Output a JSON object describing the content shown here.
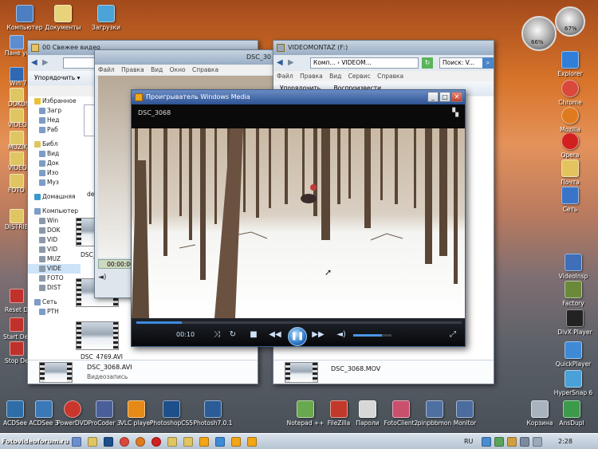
{
  "desktop": {
    "top_icons": [
      {
        "label": "Компьютер",
        "color": "#4b7fc1"
      },
      {
        "label": "Документы",
        "color": "#e8d27a"
      },
      {
        "label": "Загрузки",
        "color": "#4ba3d6"
      }
    ],
    "left_labels": [
      "Пане управл",
      "Win 7",
      "DOKUM",
      "VIDEO",
      "MUZIK",
      "VIDEO",
      "FOTO",
      "DISTRIB",
      "Reset De",
      "Start De",
      "Stop De"
    ],
    "right_icons": [
      {
        "label": "Explorer",
        "color": "#2f7fd8"
      },
      {
        "label": "Chrome",
        "color": "#d9483b"
      },
      {
        "label": "Mozilla",
        "color": "#e07a1f"
      },
      {
        "label": "Opera",
        "color": "#d21f1f"
      },
      {
        "label": "Почта",
        "color": "#e3c35e"
      },
      {
        "label": "Сеть",
        "color": "#3a74c8"
      },
      {
        "label": "VideoInsp",
        "color": "#3f6fb8"
      },
      {
        "label": "Factory",
        "color": "#6a8a3a"
      },
      {
        "label": "DivX Player",
        "color": "#222222"
      },
      {
        "label": "QuickPlayer",
        "color": "#3e8ad6"
      },
      {
        "label": "HyperSnap 6",
        "color": "#4aa0d8"
      },
      {
        "label": "Корзина",
        "color": "#a9b3bd"
      },
      {
        "label": "AnsDupl",
        "color": "#3b9b4a"
      }
    ],
    "bottom_icons": [
      {
        "label": "ACDSee",
        "color": "#2e6da8"
      },
      {
        "label": "ACDSee 3",
        "color": "#3a78b8"
      },
      {
        "label": "PowerDVD",
        "color": "#c9362c"
      },
      {
        "label": "ProCoder 3",
        "color": "#4a5f9a"
      },
      {
        "label": "VLC player",
        "color": "#e58a17"
      },
      {
        "label": "PhotoshopCS5",
        "color": "#1d4f8a"
      },
      {
        "label": "Photosh7.0.1",
        "color": "#2a5d97"
      },
      {
        "label": "Notepad ++",
        "color": "#6aa84f"
      },
      {
        "label": "FileZilla",
        "color": "#c0392b"
      },
      {
        "label": "Пароли",
        "color": "#d7d7d7"
      },
      {
        "label": "FotoClient2",
        "color": "#c94f6d"
      },
      {
        "label": "pinpbbmon",
        "color": "#4f6fa0"
      },
      {
        "label": "Monitor",
        "color": "#4b6c9c"
      }
    ],
    "gadget_values": [
      "66%",
      "67%"
    ]
  },
  "explorer1": {
    "title": "00 Свежее видео",
    "organize": "Упорядочить",
    "tree": [
      "Избранное",
      "Загр",
      "Нед",
      "Раб",
      "Библ",
      "Вид",
      "Док",
      "Изо",
      "Муз",
      "Домашняя",
      "Компьютер",
      "Win",
      "DOK",
      "VID",
      "VID",
      "MUZ",
      "VIDE",
      "FOTO",
      "DIST",
      "Сеть",
      "PTH"
    ],
    "desk_label": "des",
    "files": [
      "DSC_",
      "DSC_4769.AVI"
    ],
    "detail_name": "DSC_3068.AVI",
    "detail_type": "Видеозапись"
  },
  "player_small": {
    "title": "DSC_30",
    "menu": [
      "Файл",
      "Правка",
      "Вид",
      "Окно",
      "Справка"
    ],
    "time": "00:00:00"
  },
  "explorer2": {
    "title": "VIDEOMONTAZ (F:)",
    "address": "Комп... › VIDEOM...",
    "search": "Поиск: V...",
    "menu": [
      "Файл",
      "Правка",
      "Вид",
      "Сервис",
      "Справка"
    ],
    "toolbar": [
      "Упорядочить",
      "Воспроизвести"
    ],
    "detail_name": "DSC_3068.MOV"
  },
  "wmp": {
    "title": "Проигрыватель Windows Media",
    "now_playing": "DSC_3068",
    "time": "00:10",
    "progress": 0.14,
    "volume": 0.75
  },
  "taskbar": {
    "brand": "Fotovideoforum.ru",
    "lang": "RU",
    "clock": "2:28"
  }
}
